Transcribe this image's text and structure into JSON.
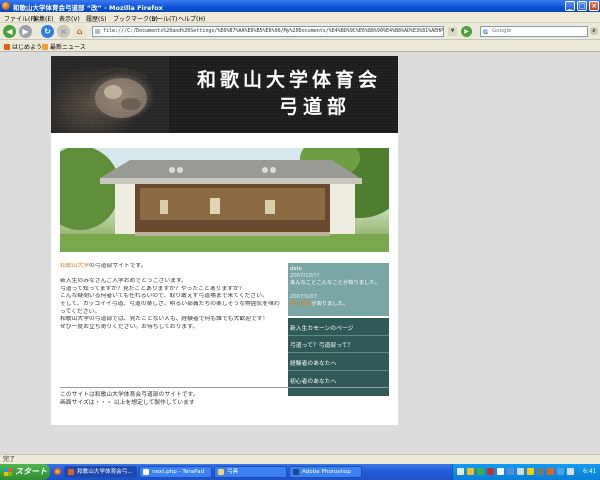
{
  "window": {
    "title": "和歌山大学体育会弓道部 “改” - Mozilla Firefox",
    "controls": [
      "minimize",
      "maximize",
      "close"
    ]
  },
  "menu": [
    "ファイル(F)",
    "編集(E)",
    "表示(V)",
    "履歴(S)",
    "ブックマーク(B)",
    "ツール(T)",
    "ヘルプ(H)"
  ],
  "toolbar": {
    "url": "file:///C:/Documents%20and%20Settings/%E6%B7%AA%E6%B5%E6%96/My%20Documents/%E4%BD%9C%E6%88%90%E4%B8%AD%E3%81%AEHP/index.html",
    "search_placeholder": "Google"
  },
  "bookmarks": [
    "はじめよう",
    "最新ニュース"
  ],
  "site": {
    "banner_title_1": "和歌山大学体育会",
    "banner_title_2": "弓道部",
    "intro": [
      {
        "parts": [
          {
            "text": "和歌山大学",
            "accent": true
          },
          {
            "text": "の弓道部サイトです。",
            "accent": false
          }
        ]
      },
      {
        "parts": [
          {
            "text": "",
            "accent": false
          }
        ]
      },
      {
        "parts": [
          {
            "text": "新入生のみなさんご入学おめでとうございます。",
            "accent": false
          }
        ]
      },
      {
        "parts": [
          {
            "text": "弓道って知ってますか？見たことありますか？やったことありますか？",
            "accent": false
          }
        ]
      },
      {
        "parts": [
          {
            "text": "こんな疑問いる何者いても任れるいので、取り敢えず弓道場まで来てください。",
            "accent": false
          }
        ]
      },
      {
        "parts": [
          {
            "text": "そして、カッコイイ弓道、弓道の楽しさ、明るい部員たちの楽しそうな雰囲気を味わってください。",
            "accent": false
          }
        ]
      },
      {
        "parts": [
          {
            "text": "和歌山大学の弓道部では、見たことない人も、経験者で何も誰でも大歓迎です！",
            "accent": false
          }
        ]
      },
      {
        "parts": [
          {
            "text": "ぜひ一度お立ち寄りください。お待ちしております。",
            "accent": false
          }
        ]
      }
    ],
    "news": {
      "label": "date",
      "items": [
        {
          "date": "2007/10/??",
          "text": "あんなことこんなことが有りました。",
          "highlight": ""
        },
        {
          "date": "2007/1/07",
          "text": "がありました。",
          "highlight": "新入部員"
        }
      ]
    },
    "links": [
      "新入生カモーンのページ",
      "弓道って？弓道部って？",
      "経験者のあなたへ",
      "初心者のあなたへ"
    ],
    "footer": [
      "このサイトは和歌山大学体育会弓道部のサイトです。",
      "画面サイズは・・・ 以上を想定して製作しています"
    ]
  },
  "status": "完了",
  "taskbar": {
    "start_label": "スタート",
    "tasks": [
      {
        "label": "和歌山大学体育会弓...",
        "active": true
      },
      {
        "label": "next.php - TeraPad",
        "active": false
      },
      {
        "label": "弓具",
        "active": false
      },
      {
        "label": "Adobe Photoshop",
        "active": false
      }
    ],
    "clock": "6:41"
  },
  "colors": {
    "accent_orange": "#e87d1e",
    "news_bg": "#7aa7a5",
    "links_bg": "#2f5a57",
    "xp_blue": "#245edc"
  }
}
